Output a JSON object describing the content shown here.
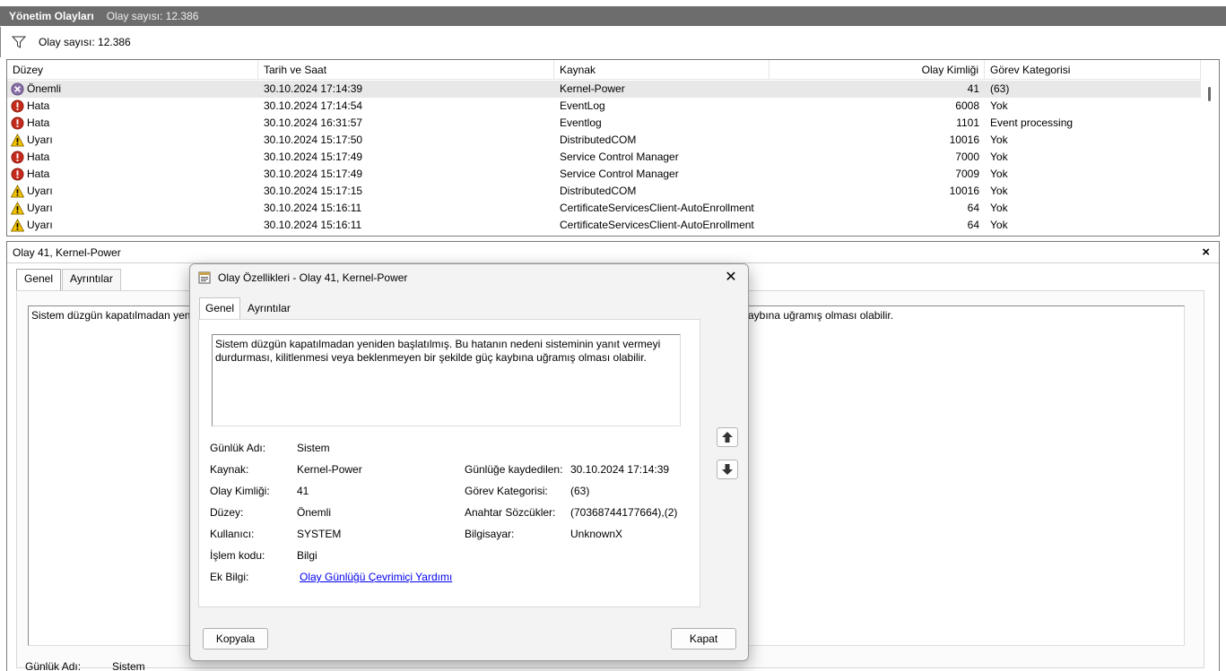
{
  "titlebar": {
    "title": "Yönetim Olayları",
    "count": "Olay sayısı: 12.386"
  },
  "filterbar": {
    "count": "Olay sayısı: 12.386"
  },
  "list": {
    "columns": [
      "Düzey",
      "Tarih ve Saat",
      "Kaynak",
      "Olay Kimliği",
      "Görev Kategorisi"
    ],
    "rows": [
      {
        "level": "Önemli",
        "icon": "critical-icon",
        "date": "30.10.2024 17:14:39",
        "source": "Kernel-Power",
        "id": "41",
        "category": "(63)"
      },
      {
        "level": "Hata",
        "icon": "error-icon",
        "date": "30.10.2024 17:14:54",
        "source": "EventLog",
        "id": "6008",
        "category": "Yok"
      },
      {
        "level": "Hata",
        "icon": "error-icon",
        "date": "30.10.2024 16:31:57",
        "source": "Eventlog",
        "id": "1101",
        "category": "Event processing"
      },
      {
        "level": "Uyarı",
        "icon": "warning-icon",
        "date": "30.10.2024 15:17:50",
        "source": "DistributedCOM",
        "id": "10016",
        "category": "Yok"
      },
      {
        "level": "Hata",
        "icon": "error-icon",
        "date": "30.10.2024 15:17:49",
        "source": "Service Control Manager",
        "id": "7000",
        "category": "Yok"
      },
      {
        "level": "Hata",
        "icon": "error-icon",
        "date": "30.10.2024 15:17:49",
        "source": "Service Control Manager",
        "id": "7009",
        "category": "Yok"
      },
      {
        "level": "Uyarı",
        "icon": "warning-icon",
        "date": "30.10.2024 15:17:15",
        "source": "DistributedCOM",
        "id": "10016",
        "category": "Yok"
      },
      {
        "level": "Uyarı",
        "icon": "warning-icon",
        "date": "30.10.2024 15:16:11",
        "source": "CertificateServicesClient-AutoEnrollment",
        "id": "64",
        "category": "Yok"
      },
      {
        "level": "Uyarı",
        "icon": "warning-icon",
        "date": "30.10.2024 15:16:11",
        "source": "CertificateServicesClient-AutoEnrollment",
        "id": "64",
        "category": "Yok"
      }
    ]
  },
  "detail": {
    "title": "Olay 41, Kernel-Power",
    "close": "×",
    "tabs": [
      "Genel",
      "Ayrıntılar"
    ],
    "text_left": "Sistem düzgün kapatılmadan yeni",
    "text_right": "aybına uğramış olması olabilir.",
    "bottom_label": "Günlük Adı:",
    "bottom_value": "Sistem"
  },
  "dialog": {
    "title": "Olay Özellikleri - Olay 41, Kernel-Power",
    "close": "✕",
    "tabs": [
      "Genel",
      "Ayrıntılar"
    ],
    "message_line1": "Sistem düzgün kapatılmadan yeniden başlatılmış. Bu hatanın nedeni sisteminin yanıt vermeyi",
    "message_line2": "durdurması, kilitlenmesi veya beklenmeyen bir şekilde güç kaybına uğramış olması olabilir.",
    "fields_left": [
      {
        "label": "Günlük Adı:",
        "value": "Sistem"
      },
      {
        "label": "Kaynak:",
        "value": "Kernel-Power"
      },
      {
        "label": "Olay Kimliği:",
        "value": "41"
      },
      {
        "label": "Düzey:",
        "value": "Önemli"
      },
      {
        "label": "Kullanıcı:",
        "value": "SYSTEM"
      },
      {
        "label": "İşlem kodu:",
        "value": "Bilgi"
      },
      {
        "label": "Ek Bilgi:",
        "value": "Olay Günlüğü Çevrimiçi Yardımı"
      }
    ],
    "fields_right": [
      {
        "label": "Günlüğe kaydedilen:",
        "value": "30.10.2024 17:14:39"
      },
      {
        "label": "Görev Kategorisi:",
        "value": "(63)"
      },
      {
        "label": "Anahtar Sözcükler:",
        "value": "(70368744177664),(2)"
      },
      {
        "label": "Bilgisayar:",
        "value": "UnknownX"
      }
    ],
    "copy_button": "Kopyala",
    "close_button": "Kapat"
  },
  "colors": {
    "titlebar": "#6d6d6d",
    "error": "#c42b1c",
    "warning": "#f2c200",
    "critical": "#8a6fa8",
    "link": "#0000ee"
  }
}
